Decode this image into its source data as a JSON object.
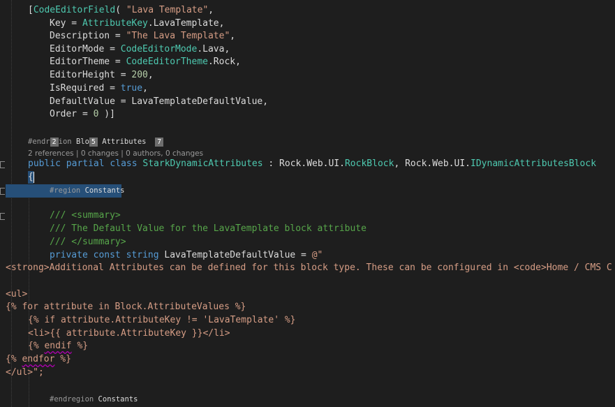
{
  "colors": {
    "background": "#1e1e1e",
    "keyword": "#569cd6",
    "type": "#4ec9b0",
    "string": "#d69d85",
    "comment": "#57a64a",
    "selection": "#264f78"
  },
  "code": {
    "l1_bracket": "[",
    "l1_attr": "CodeEditorField",
    "l1_paren": "( ",
    "l1_str": "\"Lava Template\"",
    "l1_comma": ",",
    "l2_key": "Key = ",
    "l2_type": "AttributeKey",
    "l2_rest": ".LavaTemplate,",
    "l3_key": "Description = ",
    "l3_str": "\"The Lava Template\"",
    "l3_comma": ",",
    "l4_key": "EditorMode = ",
    "l4_type": "CodeEditorMode",
    "l4_rest": ".Lava,",
    "l5_key": "EditorTheme = ",
    "l5_type": "CodeEditorTheme",
    "l5_rest": ".Rock,",
    "l6_key": "EditorHeight = ",
    "l6_num": "200",
    "l6_rest": ",",
    "l7_key": "IsRequired = ",
    "l7_kw": "true",
    "l7_rest": ",",
    "l8_key": "DefaultValue = LavaTemplateDefaultValue,",
    "l9_key": "Order = ",
    "l9_num": "0",
    "l9_rest": " )]",
    "endregion_a": "#endr",
    "endregion_b": "ion ",
    "endregion_c": "Blo",
    "endregion_d": " Attributes",
    "badge_2": "2",
    "badge_5": "5",
    "badge_7": "7",
    "lens": "2 references | 0 changes | 0 authors, 0 changes",
    "cls_public": "public",
    "cls_partial": "partial",
    "cls_class": "class",
    "cls_name": "StarkDynamicAttributes",
    "cls_colon": " : Rock.Web.UI.",
    "cls_rockblock": "RockBlock",
    "cls_mid": ", Rock.Web.UI.",
    "cls_iface": "IDynamicAttributesBlock",
    "brace_open": "{",
    "region_hash": "#region",
    "region_name": "Constants",
    "doc1": "/// <summary>",
    "doc2": "/// The Default Value for the LavaTemplate block attribute",
    "doc3": "/// </summary>",
    "priv_private": "private",
    "priv_const": "const",
    "priv_string": "string",
    "priv_rest": " LavaTemplateDefaultValue = ",
    "priv_str": "@\"",
    "s1": "<strong>Additional Attributes can be defined for this block type. These can be configured in <code>Home / CMS C",
    "s2": "<ul>",
    "s3": "{% for attribute in Block.AttributeValues %}",
    "s4": "{% if attribute.AttributeKey != 'LavaTemplate' %}",
    "s5": "<li>{{ attribute.AttributeKey }}</li>",
    "s6a": "{% ",
    "s6b": "endif",
    "s6c": " %}",
    "s7a": "{% ",
    "s7b": "endfor",
    "s7c": " %}",
    "s8": "</ul>\";",
    "endregion2_hash": "#endregion",
    "endregion2_name": "Constants"
  }
}
